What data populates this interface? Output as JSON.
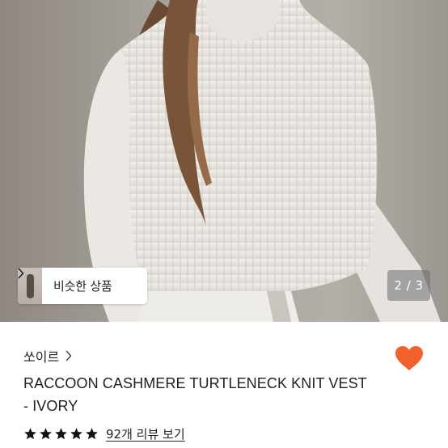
{
  "gallery": {
    "similar_products_label": "비슷한 상품",
    "page_indicator": "2 / 3",
    "current_page": 2,
    "total_pages": 3
  },
  "product": {
    "brand": "쏘이르",
    "title_line1": "RACCOON CASHMERE TURTLENECK KNIT VEST",
    "title_line2": "- IVORY",
    "rating": 5,
    "review_link": "92개 리뷰 보기"
  },
  "colors": {
    "like_heart": "#F2602B",
    "star": "#111111"
  },
  "icons": {
    "brand_chevron": "chevron-right-icon",
    "similar_chevron": "chevron-right-icon",
    "like": "heart-icon",
    "star": "star-icon"
  }
}
